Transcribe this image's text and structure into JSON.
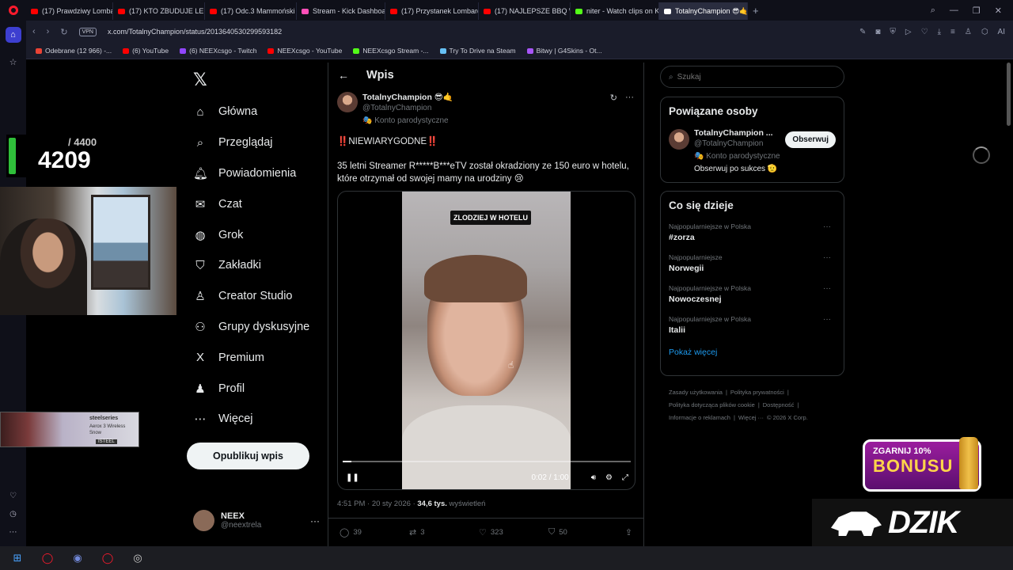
{
  "browser": {
    "tabs": [
      {
        "label": "(17) Prawdziwy Lombard",
        "color": "#ff0000"
      },
      {
        "label": "(17) KTO ZBUDUJE LEPSZY",
        "color": "#ff0000"
      },
      {
        "label": "(17) Odc.3 Mammoński",
        "color": "#ff0000"
      },
      {
        "label": "Stream - Kick Dashboard",
        "color": "#53fc18"
      },
      {
        "label": "(17) Przystanek Lombard",
        "color": "#ff0000"
      },
      {
        "label": "(17) NAJLEPSZE BBQ W P",
        "color": "#ff0000"
      },
      {
        "label": "niter - Watch clips on Kick",
        "color": "#53fc18"
      },
      {
        "label": "TotalnyChampion 😎🤙",
        "color": "#ffffff",
        "active": true
      }
    ],
    "url": "x.com/TotalnyChampion/status/2013640530299593182",
    "vpn": "VPN",
    "bookmarks": [
      {
        "label": "Odebrane (12 966) -...",
        "color": "#ea4335"
      },
      {
        "label": "(6) YouTube",
        "color": "#ff0000"
      },
      {
        "label": "(6) NEEXcsgo - Twitch",
        "color": "#9146ff"
      },
      {
        "label": "NEEXcsgo - YouTube",
        "color": "#ff0000"
      },
      {
        "label": "NEEXcsgo Stream -...",
        "color": "#53fc18"
      },
      {
        "label": "Try To Drive na Steam",
        "color": "#66c0f4"
      },
      {
        "label": "Bitwy | G4Skins - Ot...",
        "color": "#a855f7"
      }
    ]
  },
  "overlay": {
    "counter_goal": "/ 4400",
    "counter_value": "4209",
    "ad": {
      "brand": "steelseries",
      "product": "Aerox 3 Wireless Snow",
      "tag": "ISTEEL"
    },
    "bonus_top": "ZGARNIJ 10%",
    "bonus_main": "BONUSU",
    "dzik": "DZIK"
  },
  "x": {
    "nav": [
      {
        "label": "Główna",
        "icon": "home-icon",
        "glyph": "⌂"
      },
      {
        "label": "Przeglądaj",
        "icon": "search-icon",
        "glyph": "⌕"
      },
      {
        "label": "Powiadomienia",
        "icon": "bell-icon",
        "glyph": "🔔︎"
      },
      {
        "label": "Czat",
        "icon": "mail-icon",
        "glyph": "✉"
      },
      {
        "label": "Grok",
        "icon": "grok-icon",
        "glyph": "◍"
      },
      {
        "label": "Zakładki",
        "icon": "bookmark-icon",
        "glyph": "⛉"
      },
      {
        "label": "Creator Studio",
        "icon": "creator-icon",
        "glyph": "♙"
      },
      {
        "label": "Grupy dyskusyjne",
        "icon": "groups-icon",
        "glyph": "⚇"
      },
      {
        "label": "Premium",
        "icon": "x-premium-icon",
        "glyph": "X"
      },
      {
        "label": "Profil",
        "icon": "profile-icon",
        "glyph": "♟"
      },
      {
        "label": "Więcej",
        "icon": "more-icon",
        "glyph": "⋯"
      }
    ],
    "post_button": "Opublikuj wpis",
    "me": {
      "name": "NEEX",
      "handle": "@neextrela"
    },
    "post": {
      "header": "Wpis",
      "author_name": "TotalnyChampion 😎🤙",
      "author_handle": "@TotalnyChampion",
      "parody": "🎭 Konto parodystyczne",
      "line1": "‼️NIEWIARYGODNE‼️",
      "line2": "35 letni Streamer R*****B***eTV został okradziony ze 150 euro w hotelu, które otrzymał od swojej mamy na urodziny 😢",
      "video_caption": "ZLODZIEJ W HOTELU",
      "video_time": "0:02 / 1:00",
      "video_progress": 0.03,
      "time": "4:51 PM · 20 sty 2026 · ",
      "views": "34,6 tys.",
      "views_label": " wyświetleń",
      "replies": "39",
      "reposts": "3",
      "likes": "323",
      "bookmarks": "50"
    },
    "search_placeholder": "Szukaj",
    "related": {
      "title": "Powiązane osoby",
      "name": "TotalnyChampion ...",
      "handle": "@TotalnyChampion",
      "parody": "🎭 Konto parodystyczne",
      "bio": "Obserwuj po sukces 🫡",
      "follow": "Obserwuj"
    },
    "trends": {
      "title": "Co się dzieje",
      "items": [
        {
          "ctx": "Najpopularniejsze w Polska",
          "name": "#zorza"
        },
        {
          "ctx": "Najpopularniejsze",
          "name": "Norwegii"
        },
        {
          "ctx": "Najpopularniejsze w Polska",
          "name": "Nowoczesnej"
        },
        {
          "ctx": "Najpopularniejsze w Polska",
          "name": "Italii"
        }
      ],
      "show_more": "Pokaż więcej"
    },
    "footer": [
      "Zasady użytkowania",
      "|",
      "Polityka prywatności",
      "|",
      "Polityka dotycząca plików cookie",
      "|",
      "Dostępność",
      "|",
      "Informacje o reklamach",
      "|",
      "Więcej ···",
      "© 2026 X Corp."
    ]
  }
}
